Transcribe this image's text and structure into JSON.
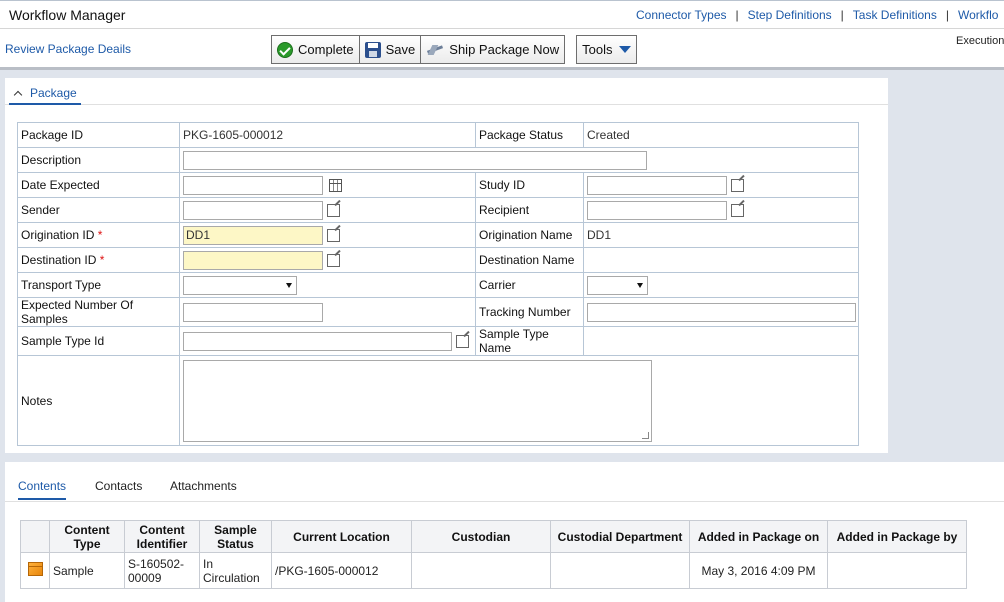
{
  "header": {
    "app_title": "Workflow Manager",
    "nav": [
      "Connector Types",
      "Step Definitions",
      "Task Definitions",
      "Workflo"
    ],
    "separator": "|"
  },
  "subbar": {
    "page_link": "Review Package Deails",
    "execution_label": "Execution:",
    "toolbar": {
      "complete": "Complete",
      "save": "Save",
      "ship": "Ship Package Now",
      "tools": "Tools"
    }
  },
  "package_panel": {
    "tab": "Package",
    "form": {
      "package_id_label": "Package ID",
      "package_id_value": "PKG-1605-000012",
      "package_status_label": "Package Status",
      "package_status_value": "Created",
      "description_label": "Description",
      "description_value": "",
      "date_expected_label": "Date Expected",
      "date_expected_value": "",
      "study_id_label": "Study ID",
      "study_id_value": "",
      "sender_label": "Sender",
      "sender_value": "",
      "recipient_label": "Recipient",
      "recipient_value": "",
      "origination_id_label": "Origination ID",
      "origination_id_value": "DD1",
      "origination_name_label": "Origination Name",
      "origination_name_value": "DD1",
      "destination_id_label": "Destination ID",
      "destination_id_value": "",
      "destination_name_label": "Destination Name",
      "destination_name_value": "",
      "transport_type_label": "Transport Type",
      "transport_type_value": "",
      "carrier_label": "Carrier",
      "carrier_value": "",
      "expected_samples_label": "Expected Number Of Samples",
      "expected_samples_value": "",
      "tracking_number_label": "Tracking Number",
      "tracking_number_value": "",
      "sample_type_id_label": "Sample Type Id",
      "sample_type_id_value": "",
      "sample_type_name_label": "Sample Type Name",
      "sample_type_name_value": "",
      "notes_label": "Notes",
      "notes_value": "",
      "required_marker": "*"
    }
  },
  "contents_panel": {
    "tabs": [
      "Contents",
      "Contacts",
      "Attachments"
    ],
    "columns": [
      "Content Type",
      "Content Identifier",
      "Sample Status",
      "Current Location",
      "Custodian",
      "Custodial Department",
      "Added in Package on",
      "Added in Package by"
    ],
    "rows": [
      {
        "icon": "package-box-icon",
        "content_type": "Sample",
        "content_identifier": "S-160502-00009",
        "sample_status": "In Circulation",
        "current_location": "/PKG-1605-000012",
        "custodian": "",
        "custodial_department": "",
        "added_on": "May 3, 2016 4:09 PM",
        "added_by": ""
      }
    ]
  },
  "colors": {
    "link": "#1e5aa8",
    "required_field_bg": "#fdf7c6",
    "page_bg": "#dfe4ec"
  }
}
